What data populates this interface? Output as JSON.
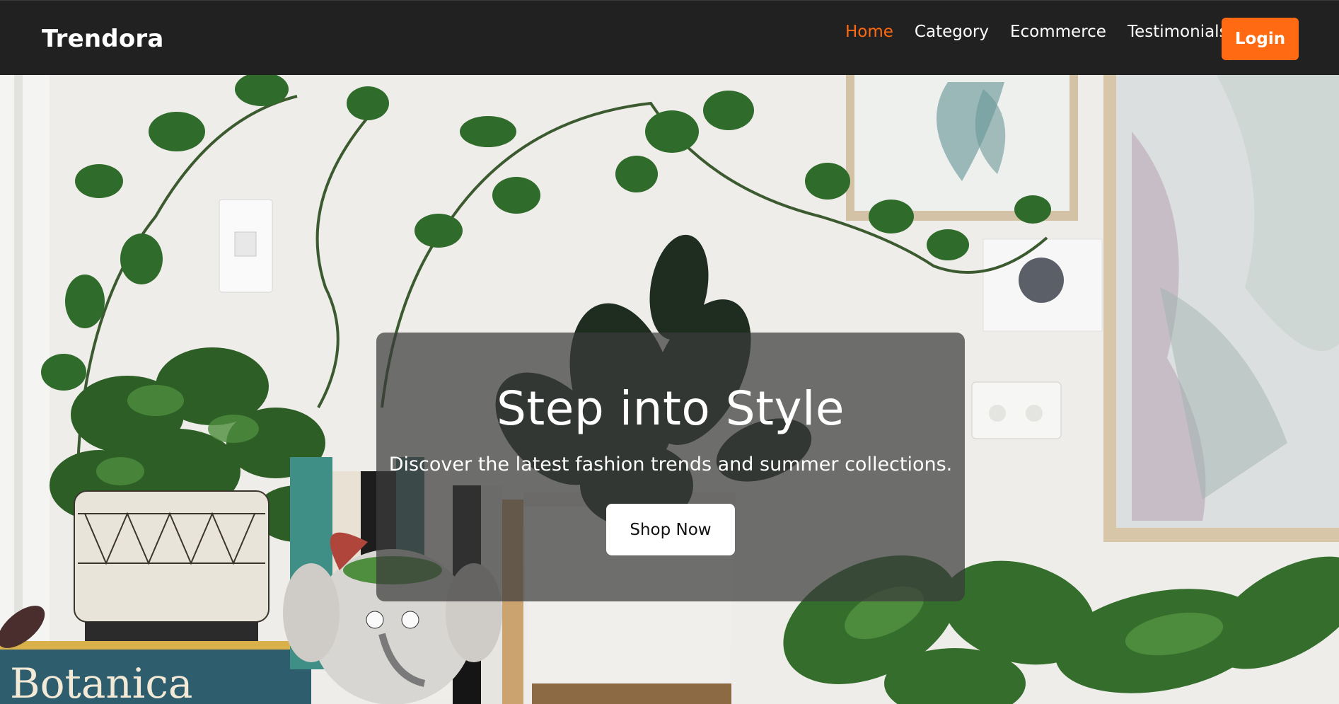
{
  "brand": {
    "name": "Trendora"
  },
  "nav": {
    "links": [
      {
        "label": "Home",
        "active": true
      },
      {
        "label": "Category",
        "active": false
      },
      {
        "label": "Ecommerce",
        "active": false
      },
      {
        "label": "Testimonials",
        "active": false
      }
    ],
    "login_label": "Login"
  },
  "hero": {
    "title": "Step into Style",
    "subtitle": "Discover the latest fashion trends and summer collections.",
    "cta_label": "Shop Now",
    "background_image_subject": "houseplants-shelf-photo",
    "book_spine_text": "Botanica"
  },
  "colors": {
    "accent": "#ff6a13",
    "navbar_bg": "#212121",
    "card_overlay": "rgba(60,60,60,0.72)",
    "text_light": "#ffffff"
  }
}
